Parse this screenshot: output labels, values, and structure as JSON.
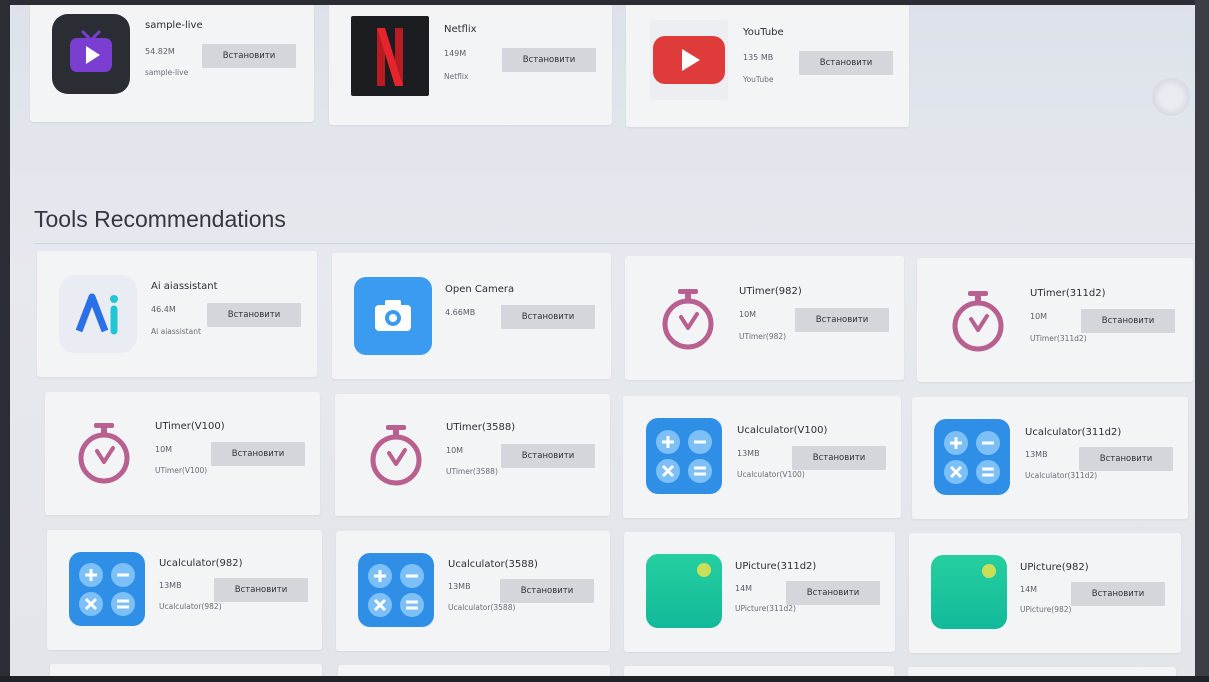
{
  "install_label": "Встановити",
  "top_apps": [
    {
      "name": "sample-live",
      "size": "54.82M",
      "publisher": "sample-live",
      "icon": "tv-play-icon"
    },
    {
      "name": "Netflix",
      "size": "149M",
      "publisher": "Netflix",
      "icon": "netflix-n-icon"
    },
    {
      "name": "YouTube",
      "size": "135 MB",
      "publisher": "YouTube",
      "icon": "youtube-play-icon"
    }
  ],
  "section_title": "Tools Recommendations",
  "tools": [
    {
      "name": "Ai aiassistant",
      "size": "46.4M",
      "publisher": "Ai aiassistant",
      "icon": "ai-assistant-icon"
    },
    {
      "name": "Open Camera",
      "size": "4.66MB",
      "publisher": "",
      "icon": "camera-icon"
    },
    {
      "name": "UTimer(982)",
      "size": "10M",
      "publisher": "UTimer(982)",
      "icon": "timer-icon"
    },
    {
      "name": "UTimer(311d2)",
      "size": "10M",
      "publisher": "UTimer(311d2)",
      "icon": "timer-icon"
    },
    {
      "name": "UTimer(V100)",
      "size": "10M",
      "publisher": "UTimer(V100)",
      "icon": "timer-icon"
    },
    {
      "name": "UTimer(3588)",
      "size": "10M",
      "publisher": "UTimer(3588)",
      "icon": "timer-icon"
    },
    {
      "name": "Ucalculator(V100)",
      "size": "13MB",
      "publisher": "Ucalculator(V100)",
      "icon": "calculator-icon"
    },
    {
      "name": "Ucalculator(311d2)",
      "size": "13MB",
      "publisher": "Ucalculator(311d2)",
      "icon": "calculator-icon"
    },
    {
      "name": "Ucalculator(982)",
      "size": "13MB",
      "publisher": "Ucalculator(982)",
      "icon": "calculator-icon"
    },
    {
      "name": "Ucalculator(3588)",
      "size": "13MB",
      "publisher": "Ucalculator(3588)",
      "icon": "calculator-icon"
    },
    {
      "name": "UPicture(311d2)",
      "size": "14M",
      "publisher": "UPicture(311d2)",
      "icon": "picture-icon"
    },
    {
      "name": "UPicture(982)",
      "size": "14M",
      "publisher": "UPicture(982)",
      "icon": "picture-icon"
    }
  ],
  "colors": {
    "timer": "#b8608f",
    "calc_bg": "#2f8fe6",
    "picture": "#19c4a0",
    "youtube": "#e03b3b",
    "netflix": "#d81f26",
    "sample_live": "#7a3fd0"
  }
}
